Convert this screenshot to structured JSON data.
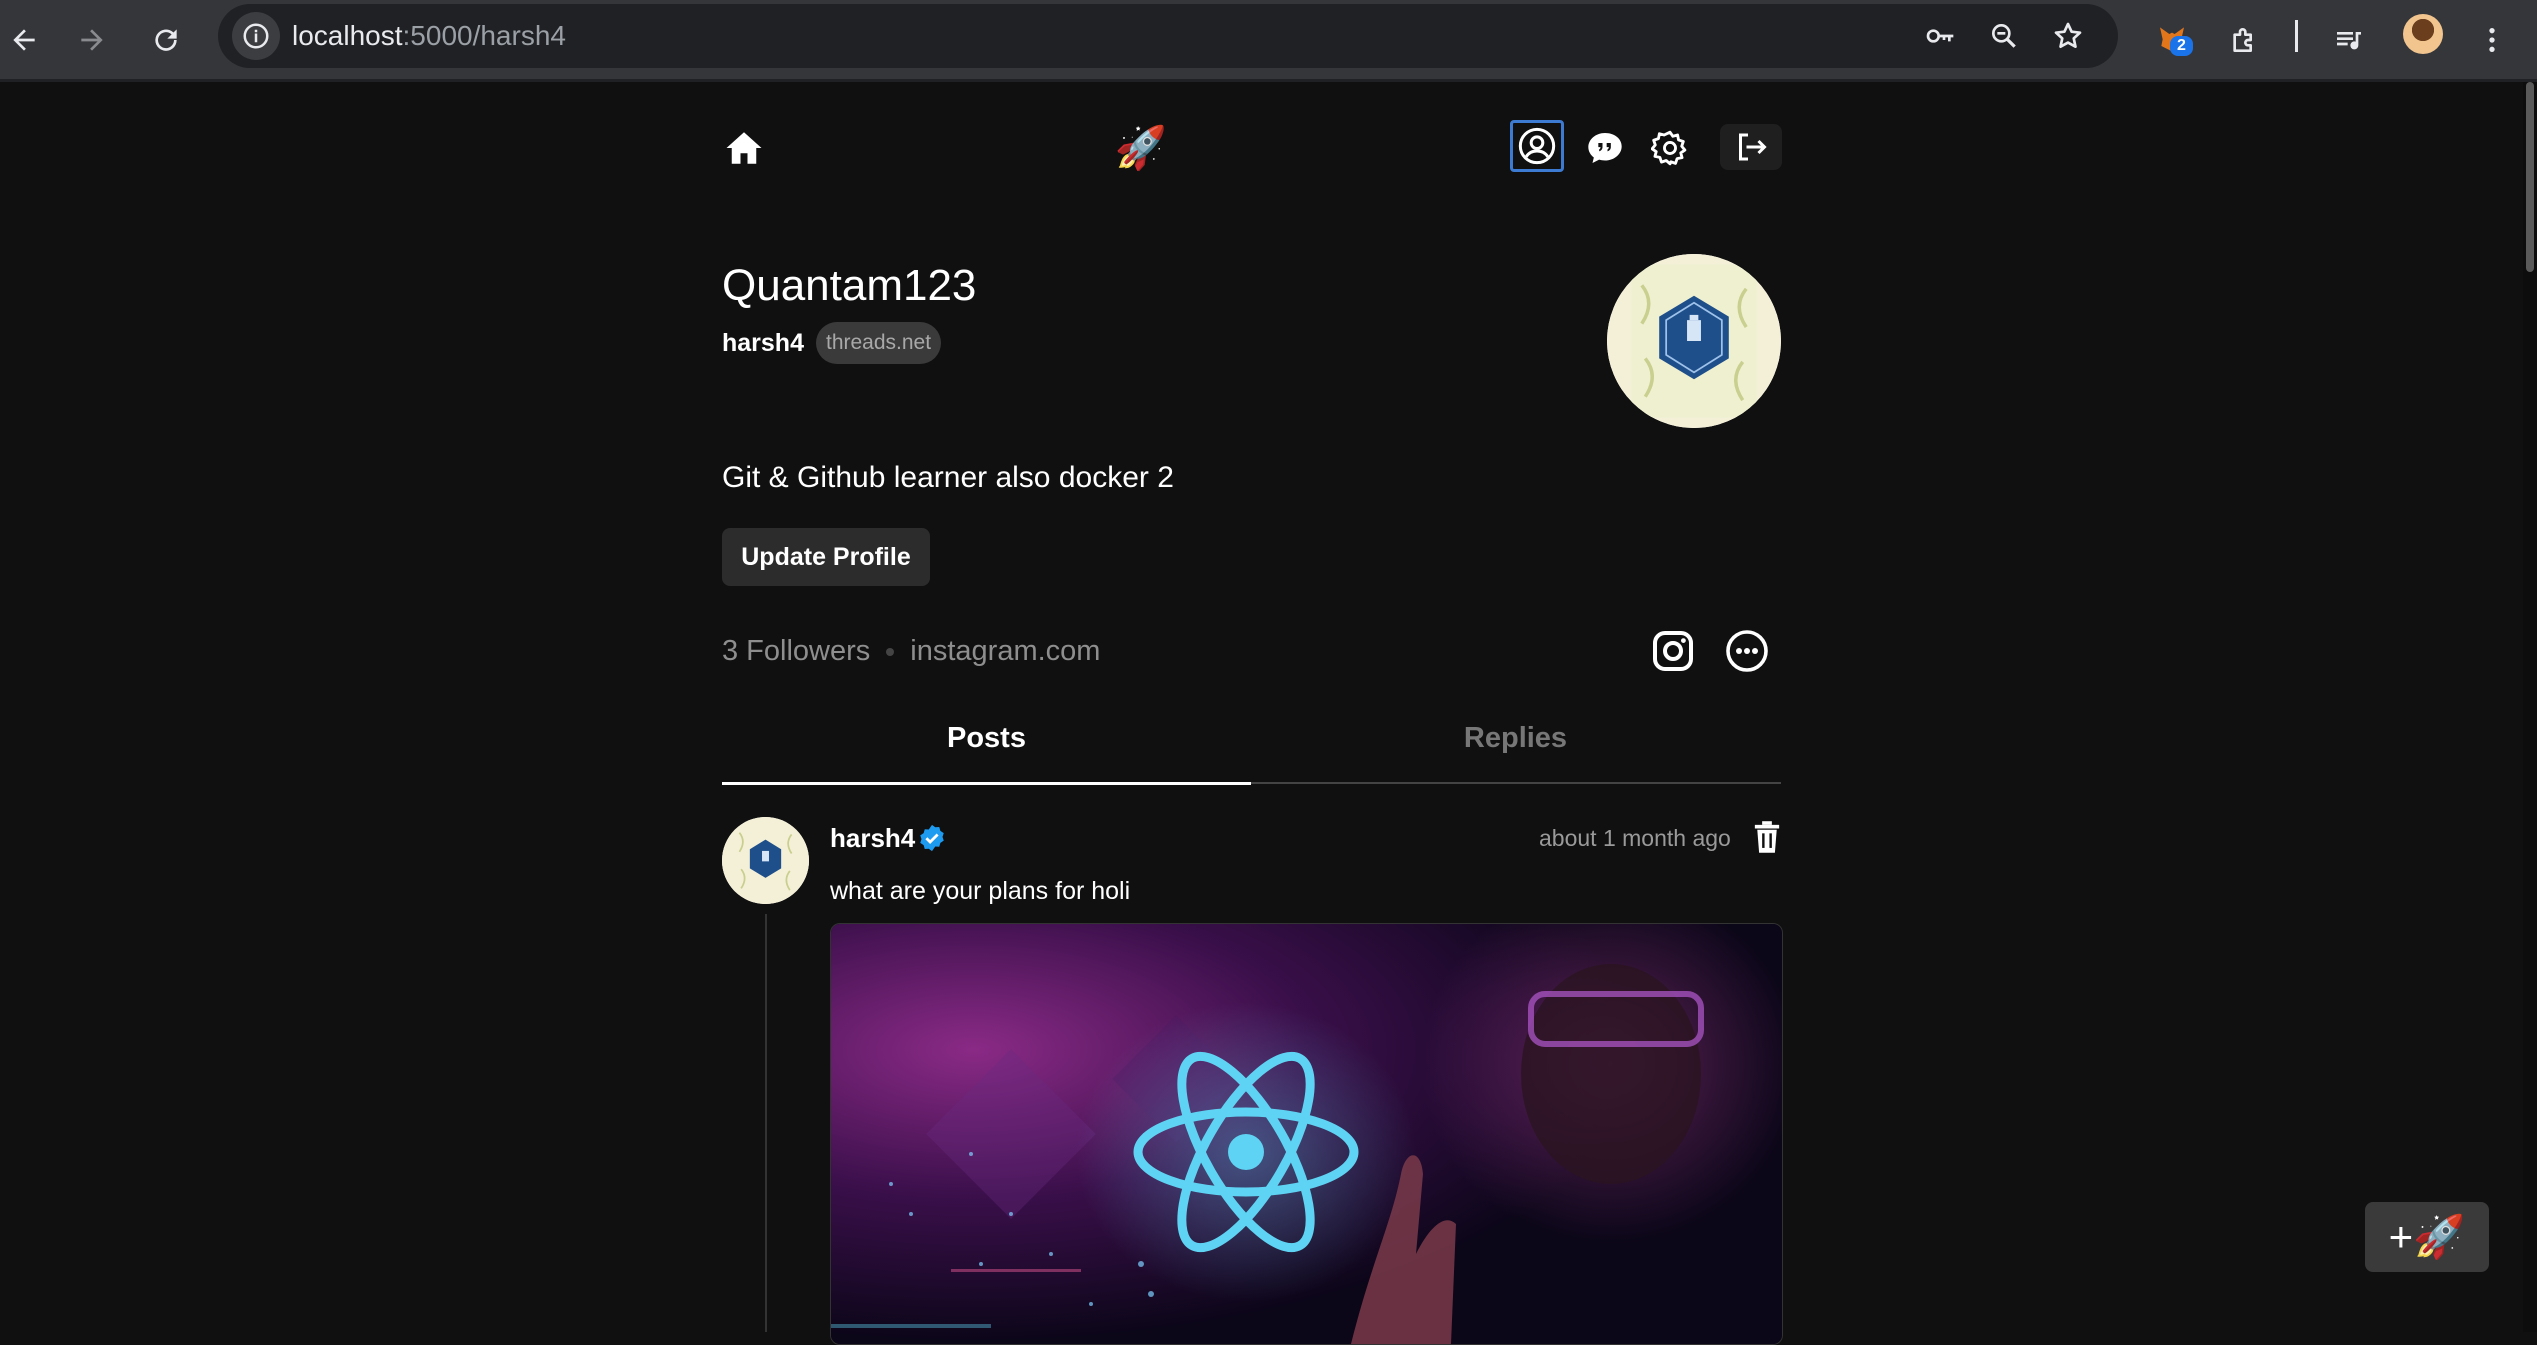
{
  "browser": {
    "url_host": "localhost",
    "url_path": ":5000/harsh4",
    "extension_badge": "2",
    "icons": [
      "back-icon",
      "forward-icon",
      "reload-icon",
      "site-info-icon",
      "key-icon",
      "zoom-icon",
      "star-icon",
      "extension-icon",
      "puzzle-icon",
      "media-icon",
      "menu-icon"
    ]
  },
  "nav": {
    "logo": "🚀",
    "icons": [
      "home-icon",
      "rocket-icon",
      "profile-icon",
      "chat-icon",
      "settings-icon",
      "logout-icon"
    ]
  },
  "profile": {
    "name": "Quantam123",
    "username": "harsh4",
    "domain": "threads.net",
    "bio": "Git & Github learner also docker 2",
    "update_label": "Update Profile",
    "followers": "3 Followers",
    "link": "instagram.com"
  },
  "tabs": {
    "posts": "Posts",
    "replies": "Replies"
  },
  "post": {
    "username": "harsh4",
    "time": "about 1 month ago",
    "text": "what are your plans for holi"
  },
  "fab": {
    "label": "+🚀"
  },
  "colors": {
    "background": "#101010",
    "accent": "#3c7bd1",
    "verified": "#1d9bf0",
    "react": "#5fd3f3"
  }
}
